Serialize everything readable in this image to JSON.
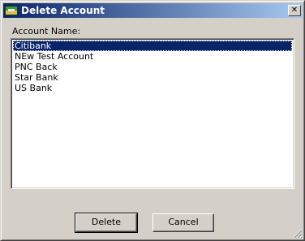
{
  "window": {
    "title": "Delete Account",
    "close_glyph": "✕"
  },
  "form": {
    "account_label": "Account Name:",
    "accounts": [
      {
        "name": "Citibank",
        "selected": true
      },
      {
        "name": "NEw Test Account",
        "selected": false
      },
      {
        "name": "PNC Back",
        "selected": false
      },
      {
        "name": "Star Bank",
        "selected": false
      },
      {
        "name": "US Bank",
        "selected": false
      }
    ]
  },
  "buttons": {
    "delete_label": "Delete",
    "cancel_label": "Cancel"
  },
  "colors": {
    "titlebar_start": "#0a246a",
    "titlebar_end": "#a6caf0",
    "selection": "#0a246a",
    "face": "#d4d0c8"
  }
}
